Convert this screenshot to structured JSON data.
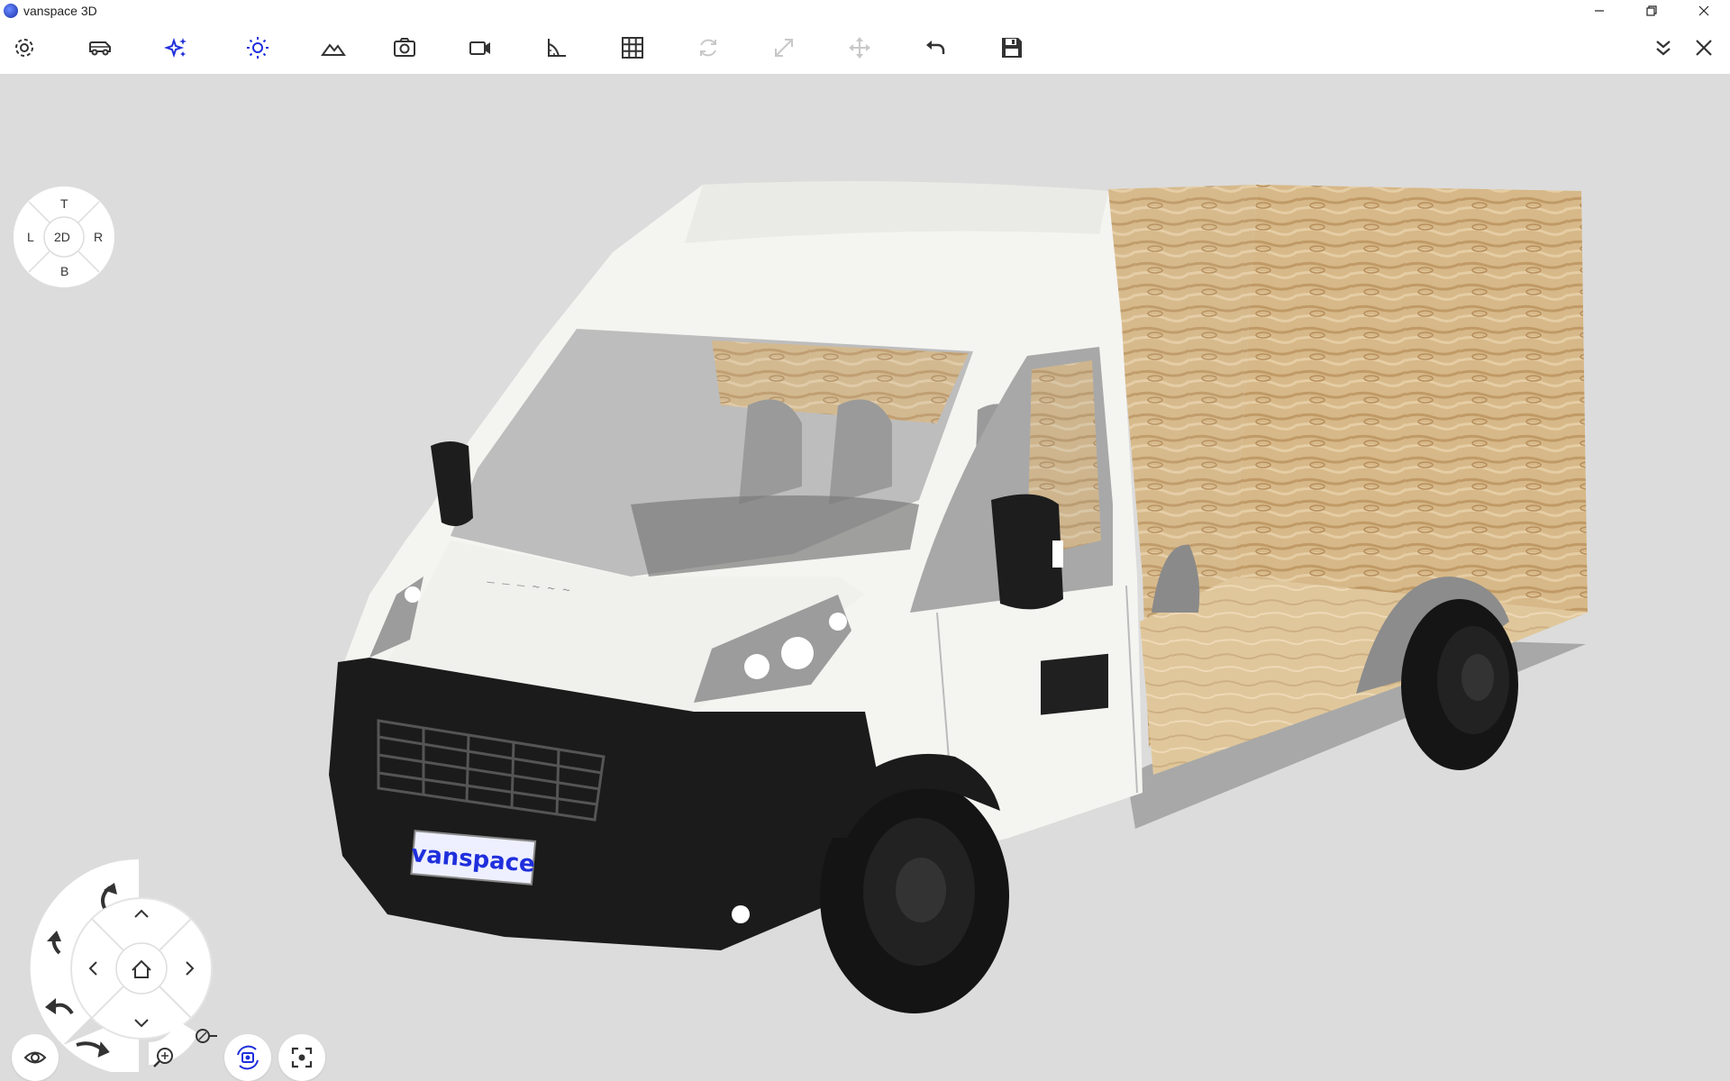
{
  "window": {
    "title": "vanspace 3D"
  },
  "toolbar": {
    "items": [
      {
        "name": "settings-icon",
        "enabled": true,
        "active": false
      },
      {
        "name": "van-icon",
        "enabled": true,
        "active": false
      },
      {
        "name": "sparkle-icon",
        "enabled": true,
        "active": true
      },
      {
        "name": "sun-icon",
        "enabled": true,
        "active": true
      },
      {
        "name": "terrain-icon",
        "enabled": true,
        "active": false
      },
      {
        "name": "camera-icon",
        "enabled": true,
        "active": false
      },
      {
        "name": "video-icon",
        "enabled": true,
        "active": false
      },
      {
        "name": "ruler-angle-icon",
        "enabled": true,
        "active": false
      },
      {
        "name": "grid-icon",
        "enabled": true,
        "active": false
      },
      {
        "name": "rotate-icon",
        "enabled": false,
        "active": false
      },
      {
        "name": "resize-icon",
        "enabled": false,
        "active": false
      },
      {
        "name": "move-icon",
        "enabled": false,
        "active": false
      },
      {
        "name": "undo-icon",
        "enabled": true,
        "active": false
      },
      {
        "name": "save-icon",
        "enabled": true,
        "active": false
      }
    ]
  },
  "view_cube": {
    "top": "T",
    "left": "L",
    "center": "2D",
    "right": "R",
    "bottom": "B"
  },
  "plate": {
    "text": "vanspace"
  },
  "colors": {
    "accent": "#1f2fdc",
    "icon": "#333333",
    "disabled": "#c8c8c8",
    "wood": "#d9bc8c",
    "van": "#f4f4f1"
  }
}
